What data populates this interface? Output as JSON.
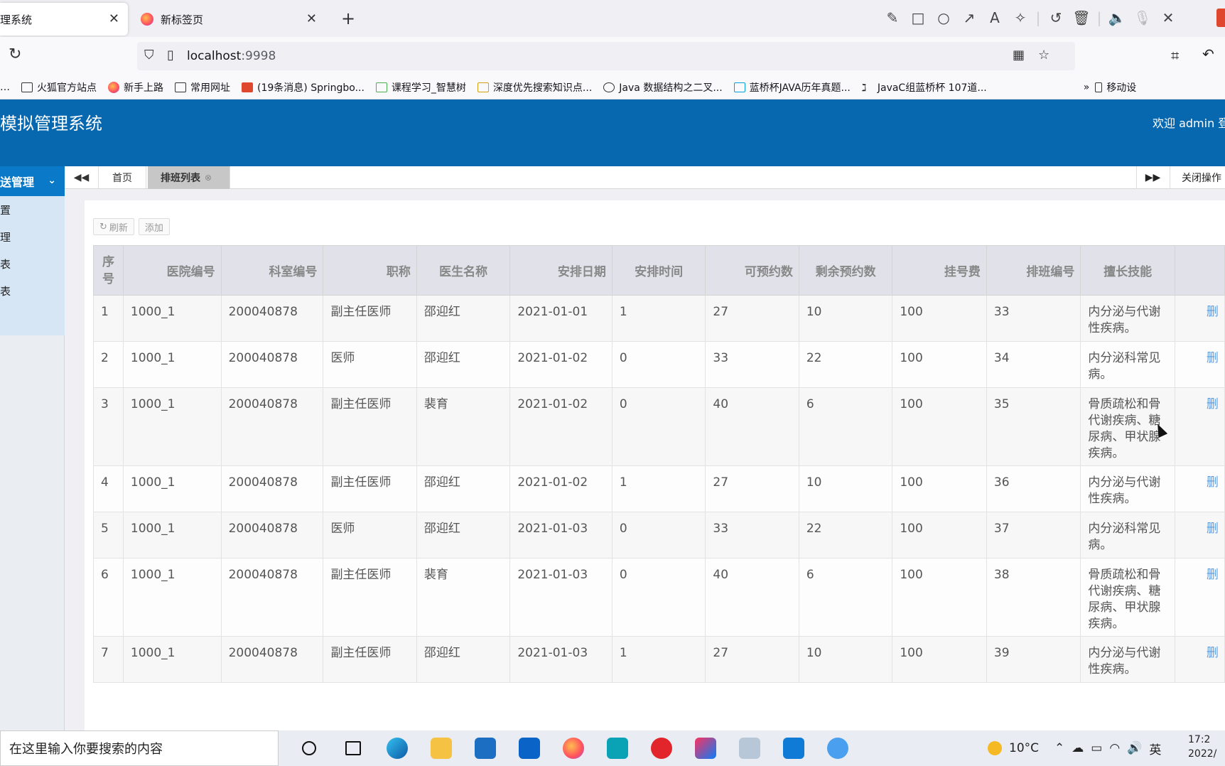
{
  "browser": {
    "tabs": [
      {
        "label": "理系统"
      },
      {
        "label": "新标签页"
      }
    ],
    "url_host": "localhost",
    "url_port": ":9998",
    "bookmarks": [
      {
        "label": "…"
      },
      {
        "label": "火狐官方站点"
      },
      {
        "label": "新手上路"
      },
      {
        "label": "常用网址"
      },
      {
        "label": "(19条消息) Springbo..."
      },
      {
        "label": "课程学习_智慧树"
      },
      {
        "label": "深度优先搜索知识点..."
      },
      {
        "label": "Java 数据结构之二叉..."
      },
      {
        "label": "蓝桥杯JAVA历年真题..."
      },
      {
        "label": "JavaC组蓝桥杯 107道..."
      }
    ],
    "bookmarks_more": "移动设"
  },
  "app": {
    "title": "约模拟管理系统",
    "welcome": "欢迎 admin 登"
  },
  "sidebar": {
    "header": "送管理",
    "items": [
      "置",
      "理",
      "表",
      "表"
    ]
  },
  "tabs": {
    "home": "首页",
    "schedule": "排班列表",
    "close_ops": "关闭操作"
  },
  "toolbar": {
    "refresh": "刷新",
    "add": "添加"
  },
  "table": {
    "headers": [
      "序号",
      "医院编号",
      "科室编号",
      "职称",
      "医生名称",
      "安排日期",
      "安排时间",
      "可预约数",
      "剩余预约数",
      "挂号费",
      "排班编号",
      "擅长技能",
      ""
    ],
    "rows": [
      [
        "1",
        "1000_1",
        "200040878",
        "副主任医师",
        "邵迎红",
        "2021-01-01",
        "1",
        "27",
        "10",
        "100",
        "33",
        "内分泌与代谢性疾病。",
        "删"
      ],
      [
        "2",
        "1000_1",
        "200040878",
        "医师",
        "邵迎红",
        "2021-01-02",
        "0",
        "33",
        "22",
        "100",
        "34",
        "内分泌科常见病。",
        "删"
      ],
      [
        "3",
        "1000_1",
        "200040878",
        "副主任医师",
        "裴育",
        "2021-01-02",
        "0",
        "40",
        "6",
        "100",
        "35",
        "骨质疏松和骨代谢疾病、糖尿病、甲状腺疾病。",
        "删"
      ],
      [
        "4",
        "1000_1",
        "200040878",
        "副主任医师",
        "邵迎红",
        "2021-01-02",
        "1",
        "27",
        "10",
        "100",
        "36",
        "内分泌与代谢性疾病。",
        "删"
      ],
      [
        "5",
        "1000_1",
        "200040878",
        "医师",
        "邵迎红",
        "2021-01-03",
        "0",
        "33",
        "22",
        "100",
        "37",
        "内分泌科常见病。",
        "删"
      ],
      [
        "6",
        "1000_1",
        "200040878",
        "副主任医师",
        "裴育",
        "2021-01-03",
        "0",
        "40",
        "6",
        "100",
        "38",
        "骨质疏松和骨代谢疾病、糖尿病、甲状腺疾病。",
        "删"
      ],
      [
        "7",
        "1000_1",
        "200040878",
        "副主任医师",
        "邵迎红",
        "2021-01-03",
        "1",
        "27",
        "10",
        "100",
        "39",
        "内分泌与代谢性疾病。",
        "删"
      ]
    ]
  },
  "taskbar": {
    "search_placeholder": "在这里输入你要搜索的内容",
    "weather": "10°C",
    "ime": "英",
    "time": "17:2",
    "date": "2022/"
  }
}
